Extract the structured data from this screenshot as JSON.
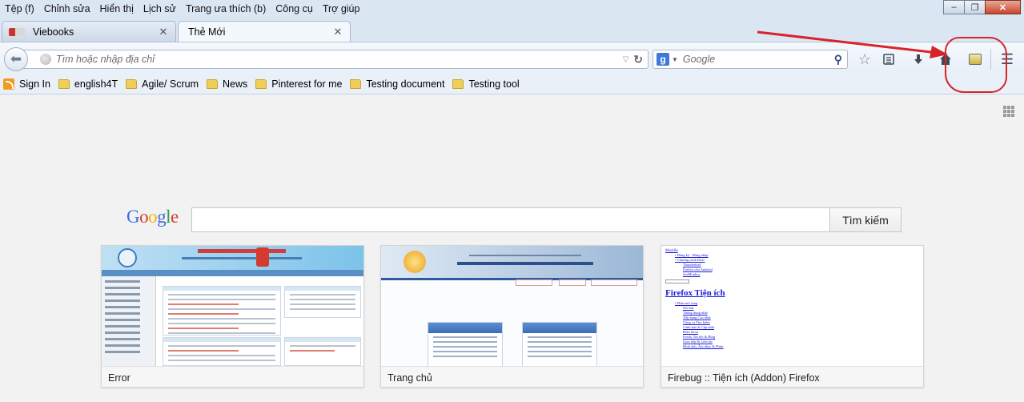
{
  "menubar": {
    "items": [
      "Tệp (f)",
      "Chỉnh sửa",
      "Hiển thị",
      "Lịch sử",
      "Trang ưa thích (b)",
      "Công cụ",
      "Trợ giúp"
    ]
  },
  "window_controls": {
    "minimize": "–",
    "maximize": "❐",
    "close": "✕"
  },
  "tabs": [
    {
      "title": "Viebooks",
      "active": false,
      "close": "✕"
    },
    {
      "title": "Thẻ Mới",
      "active": true,
      "close": "✕"
    }
  ],
  "newtab_label": "+",
  "navbar": {
    "url_placeholder": "Tìm hoặc nhập địa chỉ",
    "search_engine_letter": "g",
    "search_placeholder": "Google"
  },
  "bookmarks": [
    {
      "label": "Sign In",
      "icon": "rss-icon"
    },
    {
      "label": "english4T",
      "icon": "folder-icon"
    },
    {
      "label": "Agile/ Scrum",
      "icon": "folder-icon"
    },
    {
      "label": "News",
      "icon": "folder-icon"
    },
    {
      "label": "Pinterest for me",
      "icon": "folder-icon"
    },
    {
      "label": "Testing document",
      "icon": "folder-icon"
    },
    {
      "label": "Testing tool",
      "icon": "folder-icon"
    }
  ],
  "newtab": {
    "google_logo": [
      "G",
      "o",
      "o",
      "g",
      "l",
      "e"
    ],
    "search_button": "Tìm kiếm",
    "tiles": [
      {
        "label": "Error"
      },
      {
        "label": "Trang chủ"
      },
      {
        "label": "Firebug :: Tiện ích (Addon) Firefox"
      }
    ],
    "tile3_preview": {
      "heading": "Firefox Tiện ích"
    }
  },
  "colors": {
    "annotation": "#d6242a",
    "chrome_bg": "#dbe6f3"
  }
}
